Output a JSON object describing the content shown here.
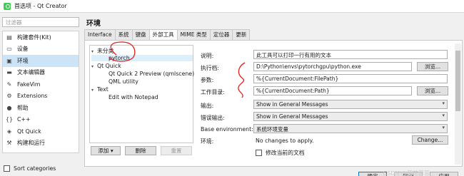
{
  "window": {
    "title": "首选项 - Qt Creator"
  },
  "sidebar": {
    "filter_placeholder": "过滤器",
    "items": [
      {
        "label": "构建套件(Kit)",
        "icon": "kit-icon"
      },
      {
        "label": "设备",
        "icon": "device-icon"
      },
      {
        "label": "环境",
        "icon": "environment-icon"
      },
      {
        "label": "文本编辑器",
        "icon": "text-editor-icon"
      },
      {
        "label": "FakeVim",
        "icon": "fakevim-icon"
      },
      {
        "label": "Extensions",
        "icon": "extensions-icon"
      },
      {
        "label": "帮助",
        "icon": "help-icon"
      },
      {
        "label": "C++",
        "icon": "cpp-icon"
      },
      {
        "label": "Qt Quick",
        "icon": "qtquick-icon"
      },
      {
        "label": "构建和运行",
        "icon": "build-run-icon"
      }
    ],
    "sort_categories": "Sort categories"
  },
  "main": {
    "title": "环境",
    "tabs": [
      "Interface",
      "系统",
      "键盘",
      "外部工具",
      "MIME 类型",
      "定位器",
      "更新"
    ],
    "tree": {
      "groups": [
        {
          "label": "未分类",
          "items": [
            "pytorch"
          ]
        },
        {
          "label": "Qt Quick",
          "items": [
            "Qt Quick 2 Preview (qmlscene)",
            "QML utility"
          ]
        },
        {
          "label": "Text",
          "items": [
            "Edit with Notepad"
          ]
        }
      ]
    },
    "buttons": {
      "add": "添加",
      "remove": "删除",
      "reset": "重置"
    },
    "form": {
      "description_label": "说明:",
      "description_value": "此工具可以打印一行有用的文本",
      "executable_label": "执行档:",
      "executable_value": "D:\\Python\\envs\\pytorchgpu\\python.exe",
      "browse": "浏览...",
      "arguments_label": "参数:",
      "arguments_value": "%{CurrentDocument:FilePath}",
      "workdir_label": "工作目录:",
      "workdir_value": "%{CurrentDocument:Path}",
      "output_label": "输出:",
      "output_value": "Show in General Messages",
      "error_output_label": "错误输出:",
      "error_output_value": "Show in General Messages",
      "base_env_label": "Base environment:",
      "base_env_value": "系统环境变量",
      "env_label": "环境:",
      "env_value": "No changes to apply.",
      "change_button": "Change...",
      "modify_doc_label": "修改当前的文档"
    }
  },
  "footer": {
    "ok": "确定",
    "cancel": "取消",
    "apply": "应用"
  },
  "watermark": "CSDN @落花蓉蓉",
  "annotation_color": "#e0201c"
}
